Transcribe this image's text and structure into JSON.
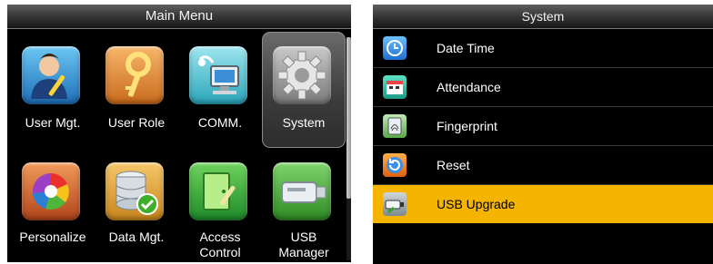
{
  "main_menu": {
    "title": "Main Menu",
    "items": [
      {
        "label": "User Mgt.",
        "icon": "user-icon"
      },
      {
        "label": "User Role",
        "icon": "key-icon"
      },
      {
        "label": "COMM.",
        "icon": "network-computer-icon"
      },
      {
        "label": "System",
        "icon": "gear-icon",
        "selected": true
      },
      {
        "label": "Personalize",
        "icon": "color-wheel-icon"
      },
      {
        "label": "Data Mgt.",
        "icon": "database-icon"
      },
      {
        "label": "Access Control",
        "label_line1": "Access",
        "label_line2": "Control",
        "icon": "door-icon"
      },
      {
        "label": "USB Manager",
        "label_line1": "USB",
        "label_line2": "Manager",
        "icon": "usb-drive-icon"
      }
    ]
  },
  "system_menu": {
    "title": "System",
    "items": [
      {
        "label": "Date Time",
        "icon": "clock-icon"
      },
      {
        "label": "Attendance",
        "icon": "attendance-icon"
      },
      {
        "label": "Fingerprint",
        "icon": "fingerprint-icon"
      },
      {
        "label": "Reset",
        "icon": "reset-icon"
      },
      {
        "label": "USB Upgrade",
        "icon": "usb-upgrade-icon",
        "selected": true
      }
    ]
  },
  "colors": {
    "selection_highlight": "#f5b400",
    "background": "#000000",
    "text": "#ffffff"
  }
}
